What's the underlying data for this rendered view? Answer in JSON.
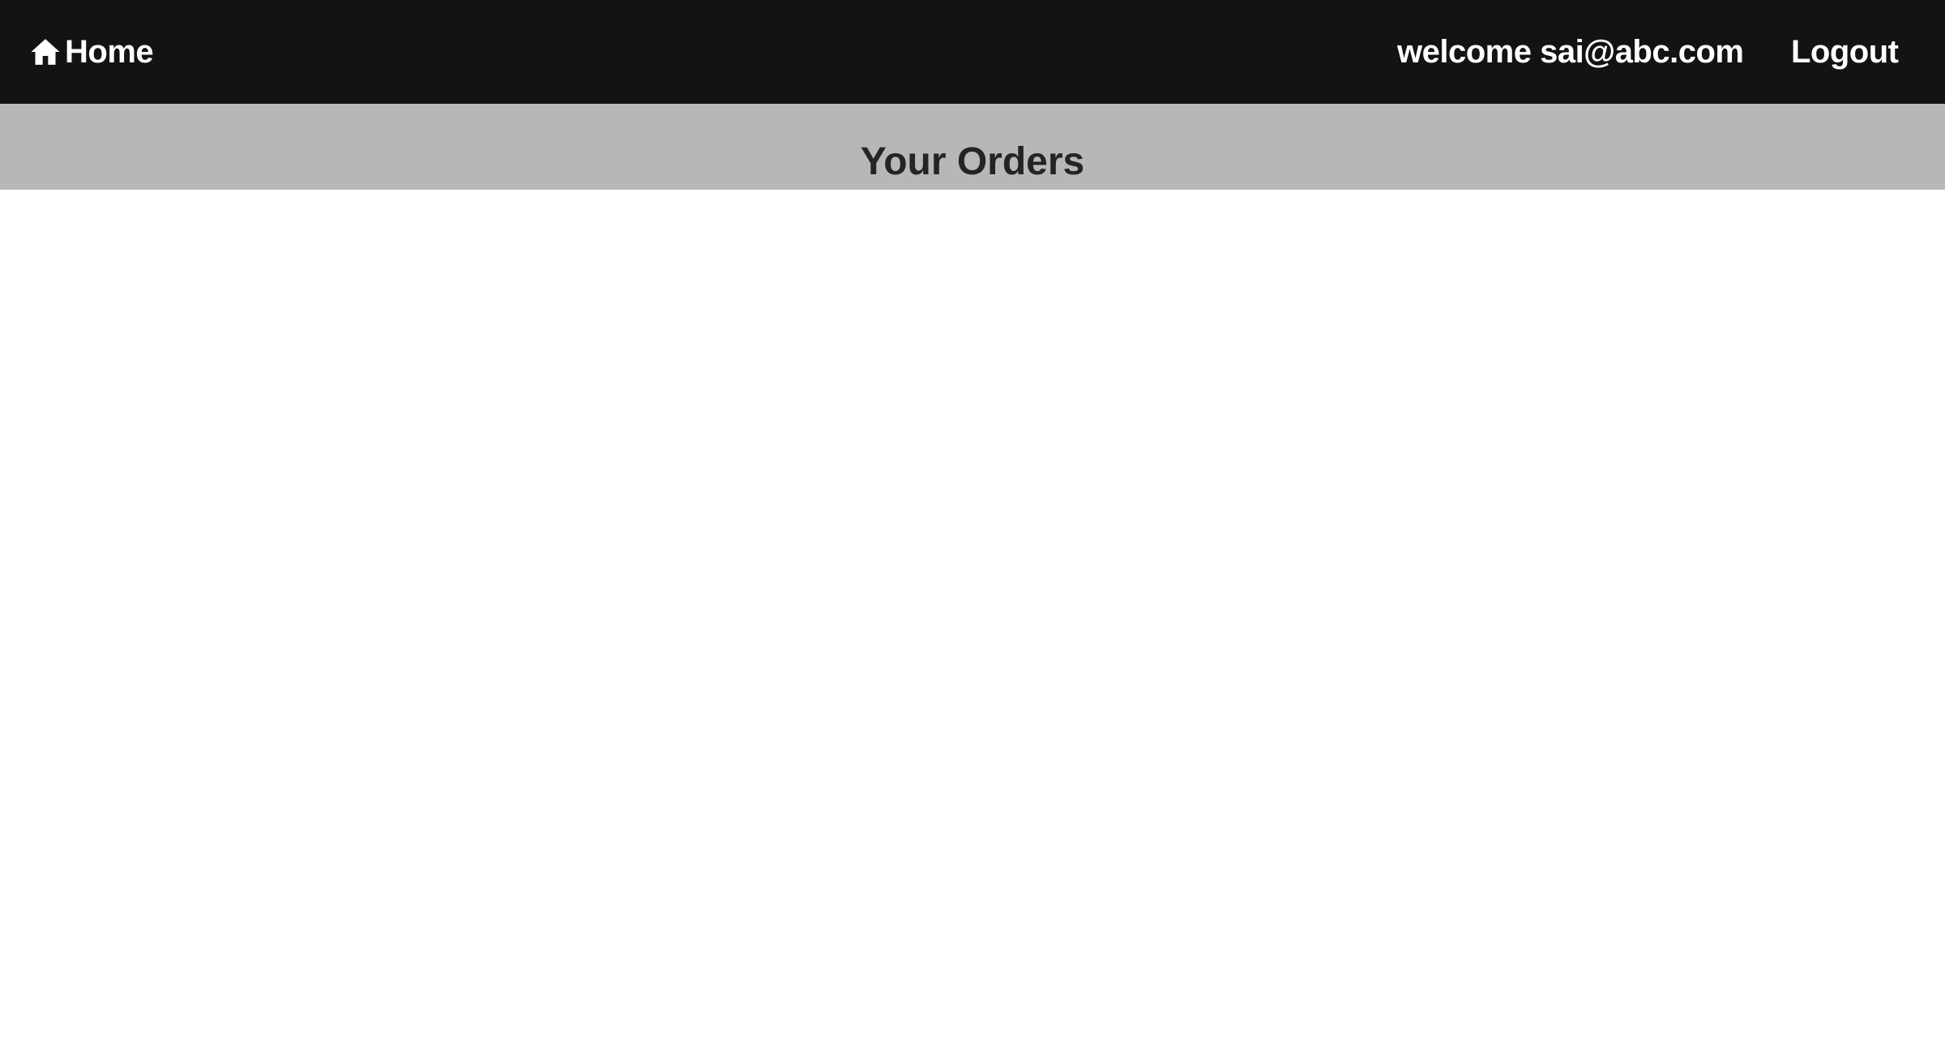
{
  "navbar": {
    "home_icon": "home-icon",
    "home_label": "Home",
    "welcome_text": "welcome sai@abc.com",
    "logout_label": "Logout",
    "background_color": "#141312",
    "text_color": "#ffffff"
  },
  "title_band": {
    "title": "Your Orders",
    "background_color": "#b8b7b8",
    "title_color": "#242426"
  }
}
